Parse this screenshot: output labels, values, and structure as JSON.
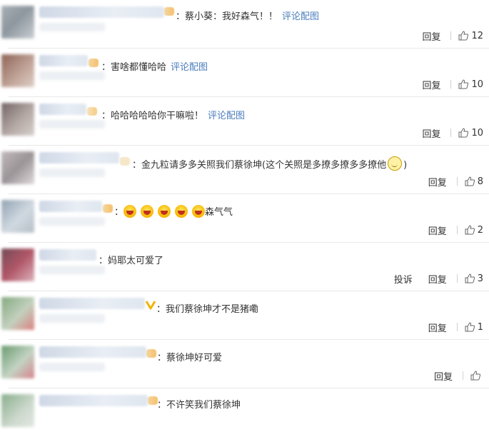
{
  "comments": [
    {
      "text": "蔡小葵：我好森气！！",
      "link": "评论配图",
      "reply": "回复",
      "report": "",
      "likes": "12"
    },
    {
      "text": "害啥都懂哈哈",
      "link": "评论配图",
      "reply": "回复",
      "report": "",
      "likes": "10"
    },
    {
      "text": "哈哈哈哈哈你干嘛啦！",
      "link": "评论配图",
      "reply": "回复",
      "report": "",
      "likes": "10"
    },
    {
      "text_before": "金九粒请多多关照我们蔡徐坤(这个关照是多撩多撩多多撩他",
      "text_after": ")",
      "reply": "回复",
      "report": "",
      "likes": "8"
    },
    {
      "text": "森气气",
      "reply": "回复",
      "report": "",
      "likes": "2"
    },
    {
      "text": "妈耶太可爱了",
      "reply": "回复",
      "report": "投诉",
      "likes": "3"
    },
    {
      "text": "我们蔡徐坤才不是猪嘞",
      "reply": "回复",
      "report": "",
      "likes": "1"
    },
    {
      "text": "蔡徐坤好可爱",
      "reply": "回复",
      "report": "",
      "likes": ""
    },
    {
      "text": "不许笑我们蔡徐坤",
      "reply": "",
      "report": "",
      "likes": ""
    }
  ]
}
